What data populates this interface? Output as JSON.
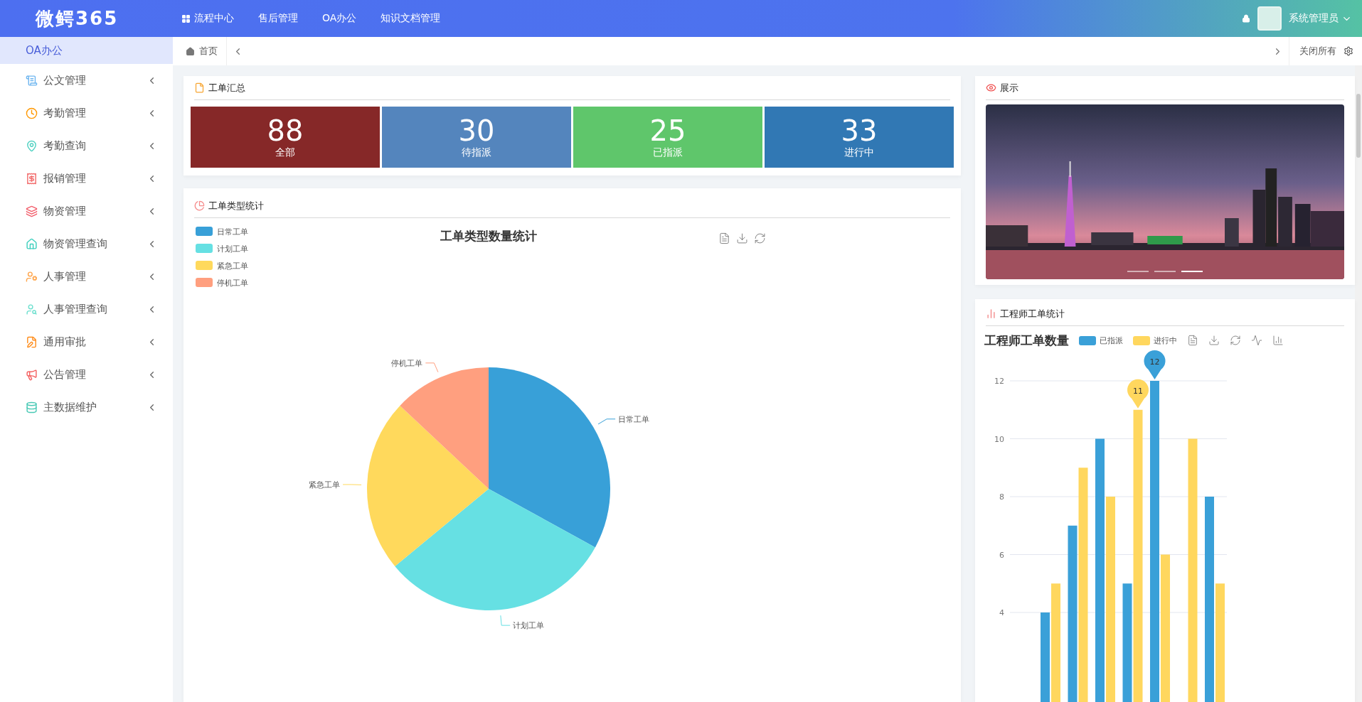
{
  "header": {
    "logo": "微鳄365",
    "nav": [
      {
        "label": "流程中心"
      },
      {
        "label": "售后管理"
      },
      {
        "label": "OA办公"
      },
      {
        "label": "知识文档管理"
      }
    ],
    "user": "系统管理员"
  },
  "sidebar": {
    "title": "OA办公",
    "items": [
      {
        "label": "公文管理"
      },
      {
        "label": "考勤管理"
      },
      {
        "label": "考勤查询"
      },
      {
        "label": "报销管理"
      },
      {
        "label": "物资管理"
      },
      {
        "label": "物资管理查询"
      },
      {
        "label": "人事管理"
      },
      {
        "label": "人事管理查询"
      },
      {
        "label": "通用审批"
      },
      {
        "label": "公告管理"
      },
      {
        "label": "主数据维护"
      }
    ]
  },
  "tabs": {
    "items": [
      {
        "label": "首页",
        "selected": true
      }
    ],
    "close_all": "关闭所有"
  },
  "summary": {
    "title": "工单汇总",
    "stats": [
      {
        "value": "88",
        "label": "全部",
        "color": "#862828"
      },
      {
        "value": "30",
        "label": "待指派",
        "color": "#5485bd"
      },
      {
        "value": "25",
        "label": "已指派",
        "color": "#5fc66b"
      },
      {
        "value": "33",
        "label": "进行中",
        "color": "#3178b4"
      }
    ]
  },
  "type_chart": {
    "title": "工单类型统计",
    "chart_data": {
      "type": "pie",
      "title": "工单类型数量统计",
      "categories": [
        "日常工单",
        "计划工单",
        "紧急工单",
        "停机工单"
      ],
      "values": [
        33,
        31,
        23,
        13
      ],
      "legend": true
    }
  },
  "showcase": {
    "title": "展示",
    "carousel": [
      {
        "selected": false
      },
      {
        "selected": false
      },
      {
        "selected": true
      }
    ]
  },
  "engineer_chart": {
    "title": "工程师工单统计",
    "chart_data": {
      "type": "bar",
      "title": "工程师工单数量",
      "series": [
        {
          "name": "已指派",
          "color": "#3aa0d8",
          "values": [
            null,
            4,
            7,
            10,
            5,
            12,
            null,
            8
          ]
        },
        {
          "name": "进行中",
          "color": "#ffd75e",
          "values": [
            null,
            5,
            9,
            8,
            11,
            6,
            10,
            5
          ]
        }
      ],
      "ylim": [
        0,
        12
      ],
      "yticks": [
        4,
        6,
        8,
        10,
        12
      ],
      "grid": true,
      "legend": true,
      "annotations": [
        {
          "text": "12",
          "y": 12
        },
        {
          "text": "11",
          "y": 11
        }
      ]
    }
  }
}
